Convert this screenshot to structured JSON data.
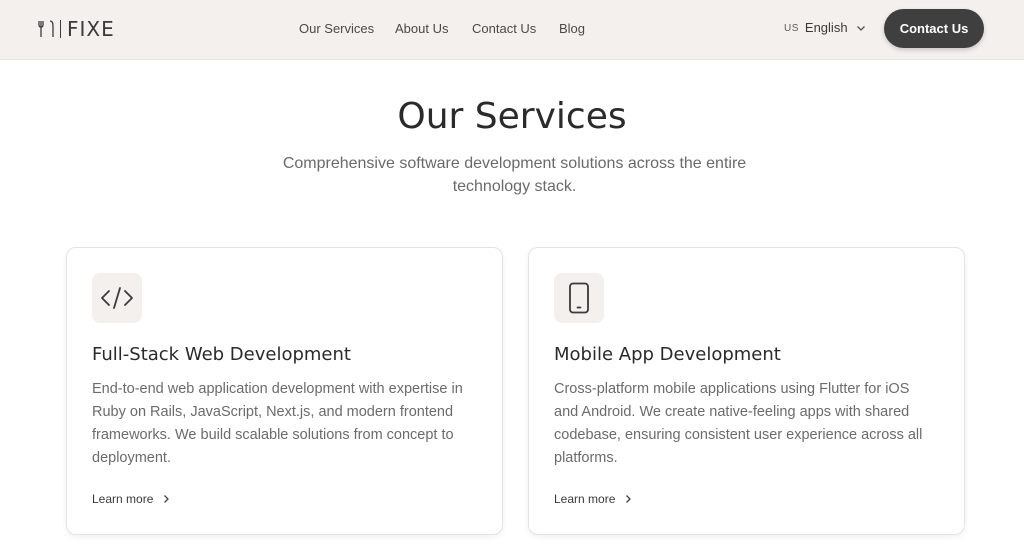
{
  "nav": {
    "logo_text": "FIXE",
    "links": [
      "Our Services",
      "About Us",
      "Contact Us",
      "Blog"
    ],
    "language": {
      "code": "US",
      "label": "English"
    },
    "cta_label": "Contact Us"
  },
  "hero": {
    "title": "Our Services",
    "subtitle": "Comprehensive software development solutions across the entire technology stack."
  },
  "services": [
    {
      "icon": "code-icon",
      "title": "Full-Stack Web Development",
      "description": "End-to-end web application development with expertise in Ruby on Rails, JavaScript, Next.js, and modern frontend frameworks. We build scalable solutions from concept to deployment.",
      "link_label": "Learn more"
    },
    {
      "icon": "smartphone-icon",
      "title": "Mobile App Development",
      "description": "Cross-platform mobile applications using Flutter for iOS and Android. We create native-feeling apps with shared codebase, ensuring consistent user experience across all platforms.",
      "link_label": "Learn more"
    }
  ],
  "colors": {
    "nav_bg": "#f3f0ee",
    "cta_bg": "#3f3f3f",
    "icon_box_bg": "#f4f0ee",
    "text_dark": "#2a2a2a",
    "text_muted": "#6b6b6b"
  }
}
